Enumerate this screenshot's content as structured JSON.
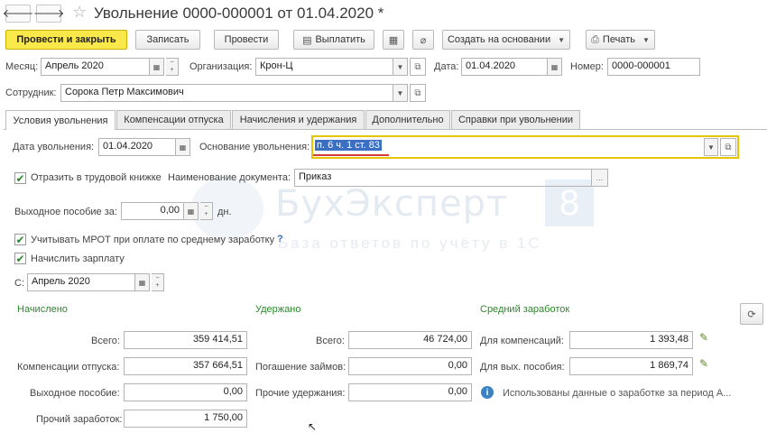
{
  "header": {
    "back_icon": "arrow-left-icon",
    "forward_icon": "arrow-right-icon",
    "title": "Увольнение 0000-000001 от 01.04.2020 *"
  },
  "toolbar": {
    "post_close": "Провести и закрыть",
    "save": "Записать",
    "post": "Провести",
    "pay": "Выплатить",
    "create_based": "Создать на основании",
    "print": "Печать"
  },
  "form": {
    "month_label": "Месяц:",
    "month_value": "Апрель 2020",
    "org_label": "Организация:",
    "org_value": "Крон-Ц",
    "date_label": "Дата:",
    "date_value": "01.04.2020",
    "number_label": "Номер:",
    "number_value": "0000-000001",
    "employee_label": "Сотрудник:",
    "employee_value": "Сорока Петр Максимович"
  },
  "tabs": [
    {
      "label": "Условия увольнения",
      "active": true
    },
    {
      "label": "Компенсации отпуска",
      "active": false
    },
    {
      "label": "Начисления и удержания",
      "active": false
    },
    {
      "label": "Дополнительно",
      "active": false
    },
    {
      "label": "Справки при увольнении",
      "active": false
    }
  ],
  "conditions": {
    "dismissal_date_label": "Дата увольнения:",
    "dismissal_date_value": "01.04.2020",
    "basis_label": "Основание увольнения:",
    "basis_value": "п. 6 ч. 1 ст. 83",
    "record_book_label": "Отразить в трудовой книжке",
    "record_book_checked": true,
    "doc_name_label": "Наименование документа:",
    "doc_name_value": "Приказ",
    "severance_label": "Выходное пособие за:",
    "severance_value": "0,00",
    "severance_unit": "дн.",
    "mrot_label": "Учитывать МРОТ при оплате по среднему заработку",
    "mrot_checked": true,
    "mrot_help": "?",
    "accrue_salary_label": "Начислить зарплату",
    "accrue_salary_checked": true,
    "from_label": "С:",
    "from_value": "Апрель 2020"
  },
  "accrued": {
    "title": "Начислено",
    "total_label": "Всего:",
    "total_value": "359 414,51",
    "vacation_comp_label": "Компенсации отпуска:",
    "vacation_comp_value": "357 664,51",
    "severance_label": "Выходное пособие:",
    "severance_value": "0,00",
    "other_label": "Прочий заработок:",
    "other_value": "1 750,00"
  },
  "withheld": {
    "title": "Удержано",
    "total_label": "Всего:",
    "total_value": "46 724,00",
    "loans_label": "Погашение займов:",
    "loans_value": "0,00",
    "other_label": "Прочие удержания:",
    "other_value": "0,00"
  },
  "average": {
    "title": "Средний заработок",
    "comp_label": "Для компенсаций:",
    "comp_value": "1 393,48",
    "severance_label": "Для вых. пособия:",
    "severance_value": "1 869,74",
    "info_text": "Использованы данные о заработке за период А..."
  },
  "watermark": {
    "brand": "БухЭксперт",
    "digit": "8",
    "tagline": "База ответов по учёту в 1С"
  },
  "colors": {
    "primary_button": "#fbe84b",
    "section_title": "#2a8a2a",
    "focus_border": "#e6c400",
    "selection": "#3a6fc4"
  }
}
